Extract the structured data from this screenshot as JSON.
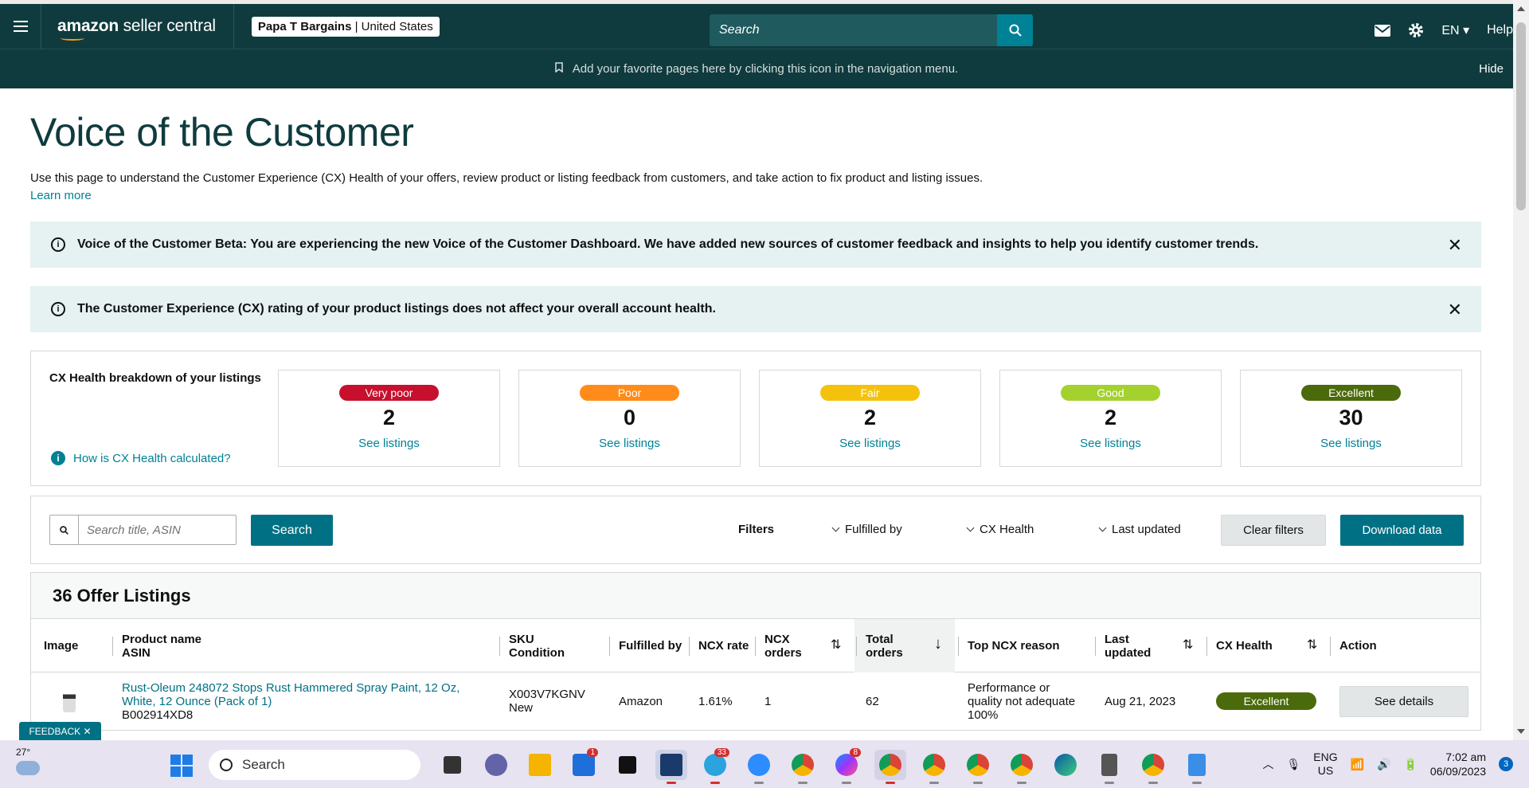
{
  "nav": {
    "logo_prefix": "amazon",
    "logo_suffix": " seller central",
    "store_name": "Papa T Bargains",
    "store_sep": " | ",
    "store_region": "United States",
    "search_placeholder": "Search",
    "lang": "EN",
    "help": "Help"
  },
  "favbar": {
    "message": "Add your favorite pages here by clicking this icon in the navigation menu.",
    "hide": "Hide"
  },
  "page": {
    "title": "Voice of the Customer",
    "description": "Use this page to understand the Customer Experience (CX) Health of your offers, review product or listing feedback from customers, and take action to fix product and listing issues.",
    "learn_more": "Learn more"
  },
  "alerts": [
    {
      "text": "Voice of the Customer Beta: You are experiencing the new Voice of the Customer Dashboard. We have added new sources of customer feedback and insights to help you identify customer trends."
    },
    {
      "text": "The Customer Experience (CX) rating of your product listings does not affect your overall account health."
    }
  ],
  "cx": {
    "title": "CX Health breakdown of your listings",
    "how": "How is CX Health calculated?",
    "cards": [
      {
        "label": "Very poor",
        "count": "2",
        "link": "See listings",
        "color": "#c7102e"
      },
      {
        "label": "Poor",
        "count": "0",
        "link": "See listings",
        "color": "#ff8c1a"
      },
      {
        "label": "Fair",
        "count": "2",
        "link": "See listings",
        "color": "#f4c20d"
      },
      {
        "label": "Good",
        "count": "2",
        "link": "See listings",
        "color": "#a4d12e"
      },
      {
        "label": "Excellent",
        "count": "30",
        "link": "See listings",
        "color": "#4b6a0b"
      }
    ]
  },
  "filters": {
    "search_placeholder": "Search title, ASIN",
    "search_button": "Search",
    "title": "Filters",
    "fulfilled_by": "Fulfilled by",
    "cx_health": "CX Health",
    "last_updated": "Last updated",
    "clear": "Clear filters",
    "download": "Download data"
  },
  "listings": {
    "title": "36 Offer Listings",
    "columns": {
      "image": "Image",
      "product_name": "Product name",
      "asin": "ASIN",
      "sku": "SKU",
      "condition": "Condition",
      "fulfilled_by": "Fulfilled by",
      "ncx_rate": "NCX rate",
      "ncx_orders_1": "NCX",
      "ncx_orders_2": "orders",
      "total_orders_1": "Total",
      "total_orders_2": "orders",
      "top_reason": "Top NCX reason",
      "last_updated_1": "Last",
      "last_updated_2": "updated",
      "cx_health": "CX Health",
      "action": "Action"
    },
    "rows": [
      {
        "product_name": "Rust-Oleum 248072 Stops Rust Hammered Spray Paint, 12 Oz, White, 12 Ounce (Pack of 1)",
        "asin": "B002914XD8",
        "sku": "X003V7KGNV",
        "condition": "New",
        "fulfilled_by": "Amazon",
        "ncx_rate": "1.61%",
        "ncx_orders": "1",
        "total_orders": "62",
        "top_reason": "Performance or quality not adequate",
        "top_reason_pct": "100%",
        "last_updated": "Aug 21, 2023",
        "cx_health": "Excellent",
        "action": "See details"
      }
    ]
  },
  "feedback": "FEEDBACK",
  "taskbar": {
    "temp": "27°",
    "search": "Search",
    "lang1": "ENG",
    "lang2": "US",
    "time": "7:02 am",
    "date": "06/09/2023",
    "notif_count": "3",
    "badges": {
      "store": "1",
      "telegram": "33",
      "messenger": "8"
    }
  }
}
